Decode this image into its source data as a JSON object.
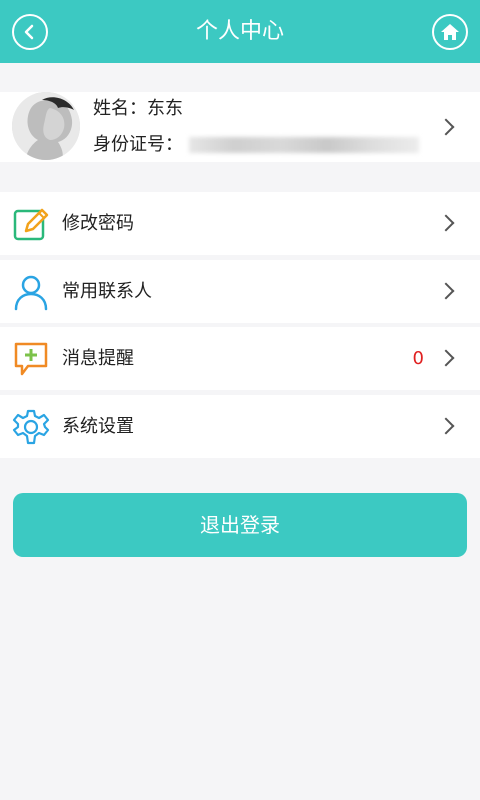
{
  "header": {
    "title": "个人中心",
    "back_icon": "back-icon",
    "home_icon": "home-icon"
  },
  "profile": {
    "name_label": "姓名：",
    "name_value": "东东",
    "id_label": "身份证号：",
    "id_value_blurred": true
  },
  "menu": [
    {
      "label": "修改密码",
      "icon": "edit-icon",
      "icon_color": "#f2a21b"
    },
    {
      "label": "常用联系人",
      "icon": "person-icon",
      "icon_color": "#2aa4e3"
    },
    {
      "label": "消息提醒",
      "icon": "message-plus-icon",
      "icon_color": "#f08a24",
      "count": "0"
    },
    {
      "label": "系统设置",
      "icon": "gear-icon",
      "icon_color": "#2aa4e3"
    }
  ],
  "logout_label": "退出登录",
  "colors": {
    "accent": "#3cc9c2",
    "count_red": "#e02020",
    "background": "#f5f5f7"
  }
}
